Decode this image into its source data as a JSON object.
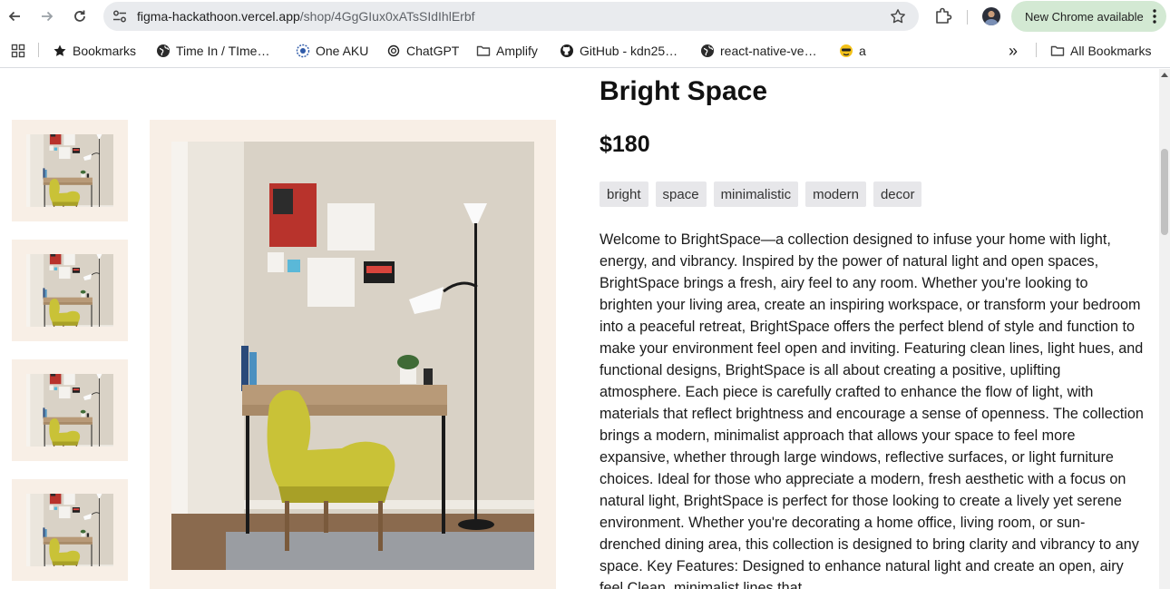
{
  "browser": {
    "url_host": "figma-hackathoon.vercel.app",
    "url_path": "/shop/4GgGIux0xATsSIdIhlErbf",
    "update_label": "New Chrome available"
  },
  "bookmarks": {
    "items": [
      {
        "label": "Bookmarks",
        "icon": "star-icon"
      },
      {
        "label": "Time In / TIme…",
        "icon": "globe-icon"
      },
      {
        "label": "One AKU",
        "icon": "flower-icon"
      },
      {
        "label": "ChatGPT",
        "icon": "chatgpt-icon"
      },
      {
        "label": "Amplify",
        "icon": "folder-icon"
      },
      {
        "label": "GitHub - kdn25…",
        "icon": "github-icon"
      },
      {
        "label": "react-native-ve…",
        "icon": "globe-icon"
      },
      {
        "label": "a",
        "icon": "emoji-icon"
      }
    ],
    "all_bookmarks_label": "All Bookmarks",
    "overflow_label": "»"
  },
  "product": {
    "title": "Bright Space",
    "price": "$180",
    "tags": [
      "bright",
      "space",
      "minimalistic",
      "modern",
      "decor"
    ],
    "description": "Welcome to BrightSpace—a collection designed to infuse your home with light, energy, and vibrancy. Inspired by the power of natural light and open spaces, BrightSpace brings a fresh, airy feel to any room. Whether you're looking to brighten your living area, create an inspiring workspace, or transform your bedroom into a peaceful retreat, BrightSpace offers the perfect blend of style and function to make your environment feel open and inviting. Featuring clean lines, light hues, and functional designs, BrightSpace is all about creating a positive, uplifting atmosphere. Each piece is carefully crafted to enhance the flow of light, with materials that reflect brightness and encourage a sense of openness. The collection brings a modern, minimalist approach that allows your space to feel more expansive, whether through large windows, reflective surfaces, or light furniture choices. Ideal for those who appreciate a modern, fresh aesthetic with a focus on natural light, BrightSpace is perfect for those looking to create a lively yet serene environment. Whether you're decorating a home office, living room, or sun-drenched dining area, this collection is designed to bring clarity and vibrancy to any space. Key Features: Designed to enhance natural light and create an open, airy feel Clean, minimalist lines that",
    "thumbnail_count": 4
  },
  "colors": {
    "image_frame": "#f8efe6",
    "tag_bg": "#e7e7ea",
    "update_pill": "#d3e9d3",
    "omnibox": "#e9ebee"
  }
}
